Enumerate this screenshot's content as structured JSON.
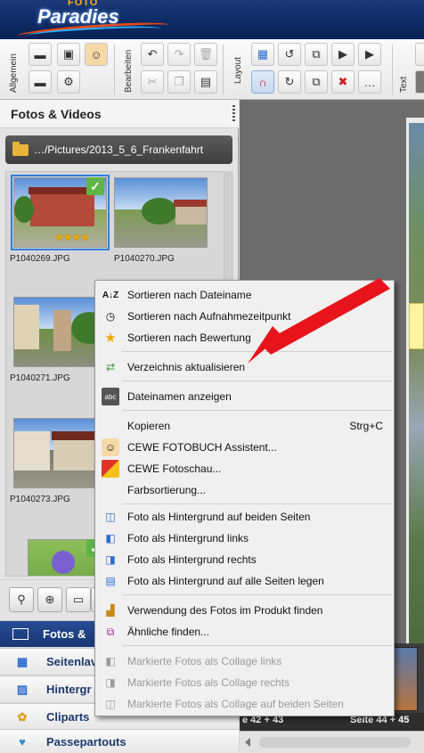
{
  "app": {
    "logo_small": "FOTO",
    "logo_main": "Paradies"
  },
  "ribbon": {
    "groups": [
      "Allgemein",
      "Bearbeiten",
      "Layout",
      "Text"
    ]
  },
  "panel": {
    "title": "Fotos & Videos",
    "path": "…/Pictures/2013_5_6_Frankenfahrt",
    "thumbnails": [
      {
        "name": "P1040269.JPG",
        "selected": true,
        "checked": true,
        "stars": "★★★★"
      },
      {
        "name": "P1040270.JPG",
        "selected": false,
        "checked": false,
        "stars": ""
      },
      {
        "name": "P1040271.JPG",
        "selected": false,
        "checked": false,
        "stars": ""
      },
      {
        "name": "P1040273.JPG",
        "selected": false,
        "checked": false,
        "stars": ""
      },
      {
        "name": "",
        "selected": false,
        "checked": true,
        "stars": ""
      }
    ]
  },
  "nav": {
    "items": [
      {
        "label": "Fotos & Videos",
        "visible": "Fotos &",
        "icon": "photos-icon"
      },
      {
        "label": "Seitenlayouts",
        "visible": "Seitenlav",
        "icon": "layout-icon"
      },
      {
        "label": "Hintergründe",
        "visible": "Hintergr",
        "icon": "background-icon"
      },
      {
        "label": "Cliparts",
        "visible": "Cliparts",
        "icon": "clipart-icon"
      },
      {
        "label": "Passepartouts",
        "visible": "Passepartouts",
        "icon": "passepartout-icon"
      }
    ]
  },
  "editor": {
    "spread_left": "e 42 + 43",
    "spread_right": "Seite 44 + 45"
  },
  "context_menu": {
    "items": [
      {
        "label": "Sortieren nach Dateiname",
        "icon": "sort-az-icon",
        "enabled": true
      },
      {
        "label": "Sortieren nach Aufnahmezeitpunkt",
        "icon": "clock-icon",
        "enabled": true
      },
      {
        "label": "Sortieren nach Bewertung",
        "icon": "star-icon",
        "enabled": true
      },
      {
        "label": "Verzeichnis aktualisieren",
        "icon": "refresh-icon",
        "enabled": true
      },
      {
        "label": "Dateinamen anzeigen",
        "icon": "filename-icon",
        "enabled": true
      },
      {
        "label": "Kopieren",
        "shortcut": "Strg+C",
        "icon": "",
        "enabled": true
      },
      {
        "label": "CEWE FOTOBUCH Assistent...",
        "icon": "assistant-icon",
        "enabled": true
      },
      {
        "label": "CEWE Fotoschau...",
        "icon": "slideshow-icon",
        "enabled": true
      },
      {
        "label": "Farbsortierung...",
        "icon": "",
        "enabled": true
      },
      {
        "label": "Foto als Hintergrund auf beiden Seiten",
        "icon": "bg-both-icon",
        "enabled": true
      },
      {
        "label": "Foto als Hintergrund links",
        "icon": "bg-left-icon",
        "enabled": true
      },
      {
        "label": "Foto als Hintergrund rechts",
        "icon": "bg-right-icon",
        "enabled": true
      },
      {
        "label": "Foto als Hintergrund auf alle Seiten legen",
        "icon": "bg-all-icon",
        "enabled": true
      },
      {
        "label": "Verwendung des Fotos im Produkt finden",
        "icon": "find-usage-icon",
        "enabled": true
      },
      {
        "label": "Ähnliche finden...",
        "icon": "find-similar-icon",
        "enabled": true
      },
      {
        "label": "Markierte Fotos als Collage links",
        "icon": "collage-left-icon",
        "enabled": false
      },
      {
        "label": "Markierte Fotos als Collage rechts",
        "icon": "collage-right-icon",
        "enabled": false
      },
      {
        "label": "Markierte Fotos als Collage auf beiden Seiten",
        "icon": "collage-both-icon",
        "enabled": false
      }
    ]
  },
  "colors": {
    "header_bg": "#0c2a63",
    "nav_active_bg": "#1f4286",
    "check_green": "#5fb548",
    "star_gold": "#f2a900",
    "annotation_arrow": "#e8141c"
  }
}
